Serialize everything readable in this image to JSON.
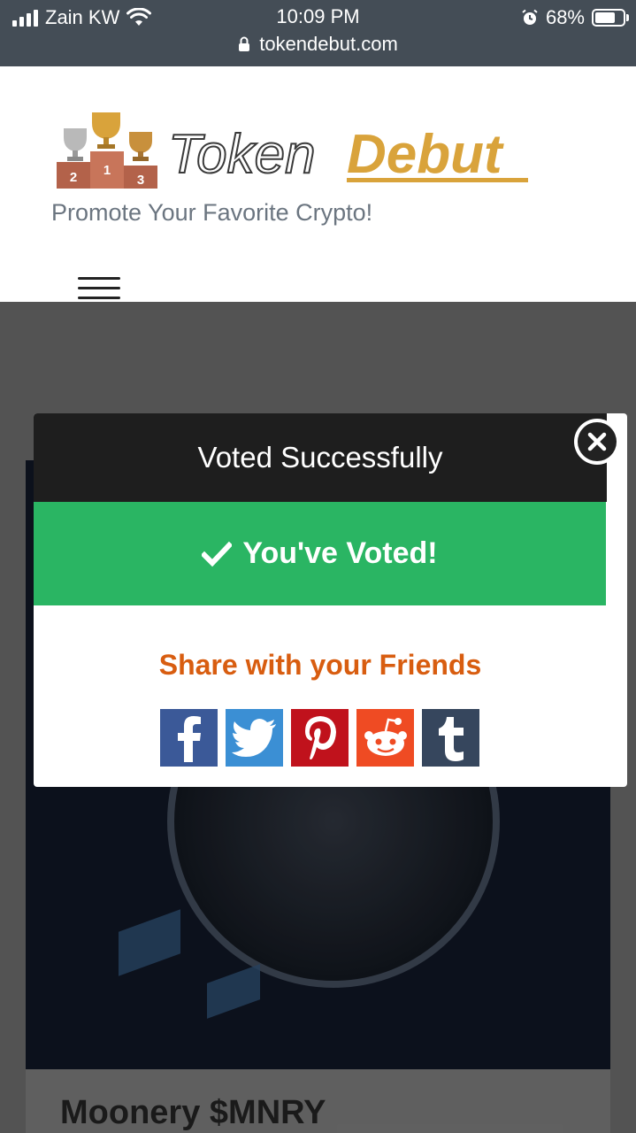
{
  "status_bar": {
    "carrier": "Zain KW",
    "time": "10:09 PM",
    "battery": "68%",
    "url": "tokendebut.com"
  },
  "header": {
    "logo": {
      "word1": "Token",
      "word2": "Debut",
      "podium": [
        "2",
        "1",
        "3"
      ]
    },
    "tagline": "Promote Your Favorite Crypto!"
  },
  "background_card": {
    "title": "Moonery $MNRY"
  },
  "modal": {
    "title": "Voted Successfully",
    "success_message": "You've Voted!",
    "share_title": "Share with your Friends",
    "share_buttons": [
      {
        "name": "facebook",
        "color": "#3b5998"
      },
      {
        "name": "twitter",
        "color": "#3b8fd4"
      },
      {
        "name": "pinterest",
        "color": "#c0121c"
      },
      {
        "name": "reddit",
        "color": "#ef4b23"
      },
      {
        "name": "tumblr",
        "color": "#36465d"
      }
    ]
  },
  "colors": {
    "status_bar_bg": "#444d56",
    "success_green": "#2ab563",
    "share_orange": "#d85d10",
    "gold": "#d9a33b"
  }
}
